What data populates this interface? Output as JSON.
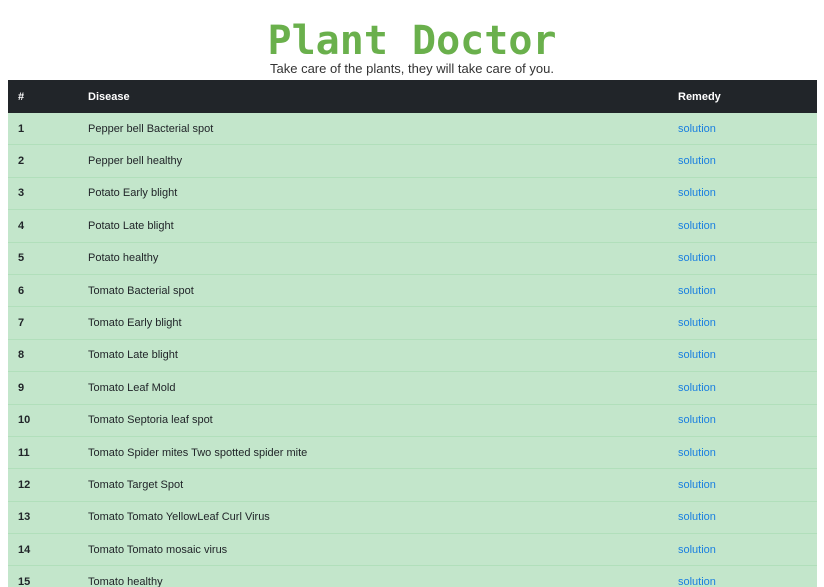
{
  "header": {
    "logo_text": "Plant Doctor",
    "tagline": "Take care of the plants, they will take care of you.",
    "brand_color": "#6ab04c"
  },
  "table": {
    "columns": [
      "#",
      "Disease",
      "Remedy"
    ],
    "header_bg": "#212529",
    "row_bg": "#c3e6cb",
    "link_color": "#1a7fe0",
    "rows": [
      {
        "num": "1",
        "disease": "Pepper bell Bacterial spot",
        "remedy": "solution"
      },
      {
        "num": "2",
        "disease": "Pepper bell healthy",
        "remedy": "solution"
      },
      {
        "num": "3",
        "disease": "Potato Early blight",
        "remedy": "solution"
      },
      {
        "num": "4",
        "disease": "Potato Late blight",
        "remedy": "solution"
      },
      {
        "num": "5",
        "disease": "Potato healthy",
        "remedy": "solution"
      },
      {
        "num": "6",
        "disease": "Tomato Bacterial spot",
        "remedy": "solution"
      },
      {
        "num": "7",
        "disease": "Tomato Early blight",
        "remedy": "solution"
      },
      {
        "num": "8",
        "disease": "Tomato Late blight",
        "remedy": "solution"
      },
      {
        "num": "9",
        "disease": "Tomato Leaf Mold",
        "remedy": "solution"
      },
      {
        "num": "10",
        "disease": "Tomato Septoria leaf spot",
        "remedy": "solution"
      },
      {
        "num": "11",
        "disease": "Tomato Spider mites Two spotted spider mite",
        "remedy": "solution"
      },
      {
        "num": "12",
        "disease": "Tomato Target Spot",
        "remedy": "solution"
      },
      {
        "num": "13",
        "disease": "Tomato Tomato YellowLeaf Curl Virus",
        "remedy": "solution"
      },
      {
        "num": "14",
        "disease": "Tomato Tomato mosaic virus",
        "remedy": "solution"
      },
      {
        "num": "15",
        "disease": "Tomato healthy",
        "remedy": "solution"
      }
    ]
  }
}
